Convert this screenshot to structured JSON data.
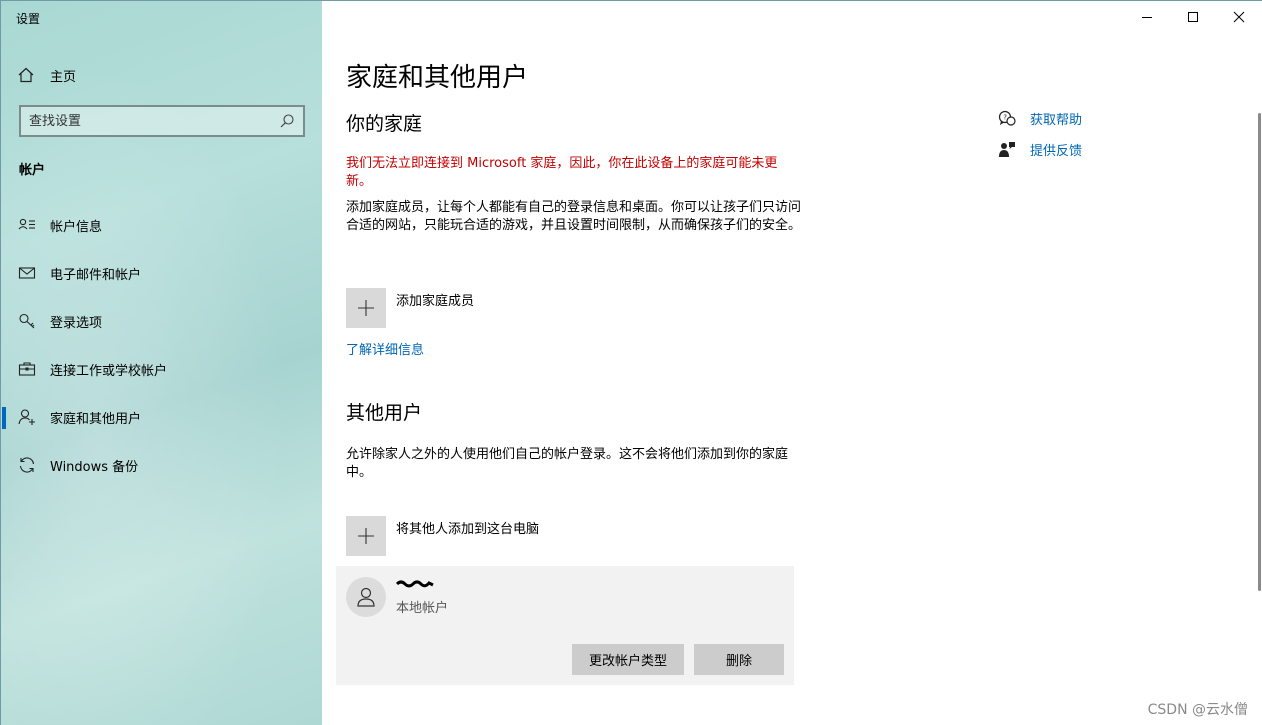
{
  "app": {
    "title": "设置"
  },
  "sidebar": {
    "home_label": "主页",
    "search_placeholder": "查找设置",
    "section_label": "帐户",
    "items": [
      {
        "label": "帐户信息",
        "icon": "user-card-icon"
      },
      {
        "label": "电子邮件和帐户",
        "icon": "mail-icon"
      },
      {
        "label": "登录选项",
        "icon": "key-icon"
      },
      {
        "label": "连接工作或学校帐户",
        "icon": "briefcase-icon"
      },
      {
        "label": "家庭和其他用户",
        "icon": "add-user-icon",
        "active": true
      },
      {
        "label": "Windows 备份",
        "icon": "sync-icon"
      }
    ]
  },
  "main": {
    "title": "家庭和其他用户",
    "family": {
      "heading": "你的家庭",
      "warning": "我们无法立即连接到 Microsoft 家庭，因此，你在此设备上的家庭可能未更新。",
      "description": "添加家庭成员，让每个人都能有自己的登录信息和桌面。你可以让孩子们只访问合适的网站，只能玩合适的游戏，并且设置时间限制，从而确保孩子们的安全。",
      "add_label": "添加家庭成员",
      "learn_more": "了解详细信息"
    },
    "others": {
      "heading": "其他用户",
      "description": "允许除家人之外的人使用他们自己的帐户登录。这不会将他们添加到你的家庭中。",
      "add_label": "将其他人添加到这台电脑",
      "user": {
        "type": "本地帐户",
        "change_button": "更改帐户类型",
        "delete_button": "删除"
      }
    },
    "help": {
      "get_help": "获取帮助",
      "feedback": "提供反馈"
    }
  },
  "watermark": "CSDN @云水僧",
  "colors": {
    "accent": "#0067c0",
    "link": "#0066b4",
    "warning": "#c50000",
    "tile": "#d9d9d9",
    "button": "#cccccc",
    "card": "#f2f2f2"
  }
}
